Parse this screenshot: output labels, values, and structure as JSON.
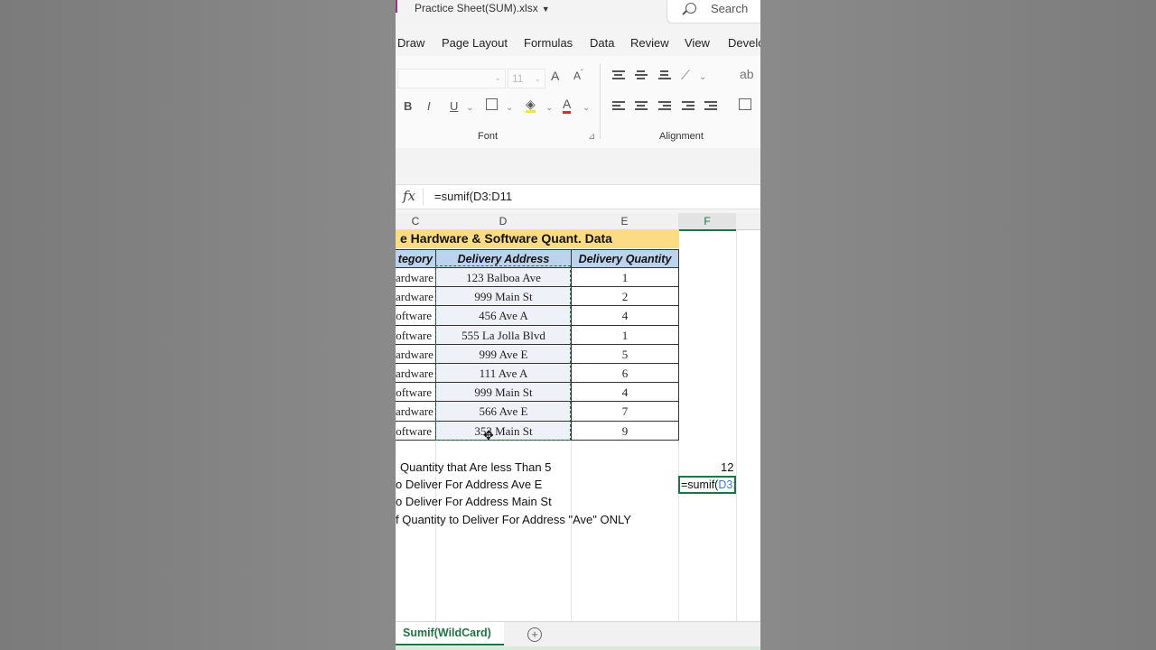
{
  "titlebar": {
    "document_title": "Practice Sheet(SUM).xlsx",
    "search_label": "Search"
  },
  "menu": [
    "Draw",
    "Page Layout",
    "Formulas",
    "Data",
    "Review",
    "View",
    "Develo"
  ],
  "ribbon": {
    "font_size": "11",
    "bold": "B",
    "italic": "I",
    "underline": "U",
    "grow_font": "A",
    "font_color": "A",
    "dropdown": "⌄",
    "font_group_label": "Font",
    "alignment_group_label": "Alignment"
  },
  "formula_bar": {
    "fx_label": "fx",
    "formula": "=sumif(D3:D11"
  },
  "columns": [
    "C",
    "D",
    "E",
    "F"
  ],
  "table": {
    "title": "e Hardware & Software Quant. Data",
    "headers": [
      "tegory",
      "Delivery Address",
      "Delivery Quantity"
    ],
    "rows": [
      {
        "category": "ardware",
        "address": "123 Balboa Ave",
        "qty": "1"
      },
      {
        "category": "ardware",
        "address": "999 Main St",
        "qty": "2"
      },
      {
        "category": "oftware",
        "address": "456 Ave A",
        "qty": "4"
      },
      {
        "category": "oftware",
        "address": "555 La Jolla Blvd",
        "qty": "1"
      },
      {
        "category": "ardware",
        "address": "999 Ave E",
        "qty": "5"
      },
      {
        "category": "ardware",
        "address": "111 Ave A",
        "qty": "6"
      },
      {
        "category": "oftware",
        "address": "999 Main St",
        "qty": "4"
      },
      {
        "category": "ardware",
        "address": "566 Ave E",
        "qty": "7"
      },
      {
        "category": "oftware",
        "address": "353 Main St",
        "qty": "9"
      }
    ]
  },
  "summary": {
    "lines": [
      "Quantity that Are less Than 5",
      "o Deliver For Address Ave E",
      "o Deliver For Address Main St",
      "f Quantity to Deliver For Address \"Ave\" ONLY"
    ],
    "result_1": "12",
    "active_formula_fn": "=sumif(",
    "active_formula_ref": "D3:D11"
  },
  "sheet_tab": {
    "name": "Sumif(WildCard)",
    "add_symbol": "+"
  },
  "colors": {
    "excel_green": "#217346",
    "banner_yellow": "#fbdc84",
    "header_blue": "#bcd3ee",
    "ref_blue": "#3d7bd6"
  }
}
